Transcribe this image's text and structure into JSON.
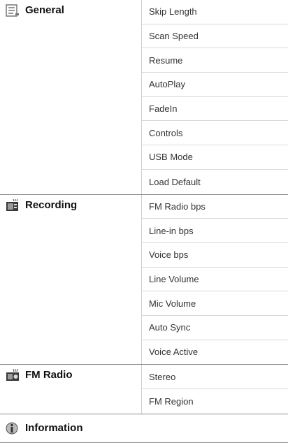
{
  "sections": [
    {
      "title": "General",
      "icon": "general-list-icon",
      "items": [
        "Skip Length",
        "Scan Speed",
        "Resume",
        "AutoPlay",
        "FadeIn",
        "Controls",
        "USB Mode",
        "Load Default"
      ]
    },
    {
      "title": "Recording",
      "icon": "recording-icon",
      "items": [
        "FM Radio bps",
        "Line-in bps",
        "Voice bps",
        "Line Volume",
        "Mic Volume",
        "Auto Sync",
        "Voice Active"
      ]
    },
    {
      "title": "FM Radio",
      "icon": "fm-radio-icon",
      "items": [
        "Stereo",
        "FM Region"
      ]
    }
  ],
  "information": {
    "title": "Information",
    "icon": "information-icon"
  }
}
